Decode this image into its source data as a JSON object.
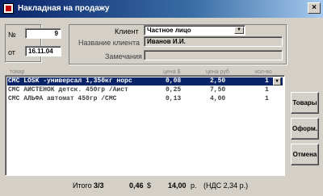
{
  "window": {
    "title": "Накладная на продажу",
    "close_glyph": "×"
  },
  "doc": {
    "number_label": "№",
    "number": "9",
    "date_label": "от",
    "date": "16.11.04"
  },
  "client": {
    "client_label": "Клиент",
    "client_value": "Частное лицо",
    "name_label": "Название клиента",
    "name_value": "Иванов И.И.",
    "remarks_label": "Замечания",
    "remarks_value": ""
  },
  "table": {
    "headers": {
      "item": "товар",
      "price_usd": "цена $",
      "price_rub": "цена руб.",
      "qty": "кол-во"
    },
    "rows": [
      {
        "item": "СМС LOSK -универсал 1,350кг норс",
        "price_usd": "0,08",
        "price_rub": "2,50",
        "qty": "1"
      },
      {
        "item": "СМС АИСТЕНОК детск. 450гр /Аист",
        "price_usd": "0,25",
        "price_rub": "7,50",
        "qty": "1"
      },
      {
        "item": "СМС АЛЬФА автомат  450гр /СМС",
        "price_usd": "0,13",
        "price_rub": "4,00",
        "qty": "1"
      }
    ],
    "selected_row": 0
  },
  "buttons": {
    "goods": "Товары",
    "checkout": "Оформ.",
    "cancel": "Отмена"
  },
  "footer": {
    "total_label": "Итого",
    "total_count": "3/3",
    "sum_usd": "0,46",
    "usd_unit": "$",
    "sum_rub": "14,00",
    "rub_unit": "р.",
    "vat": "(НДС 2,34 р.)"
  }
}
